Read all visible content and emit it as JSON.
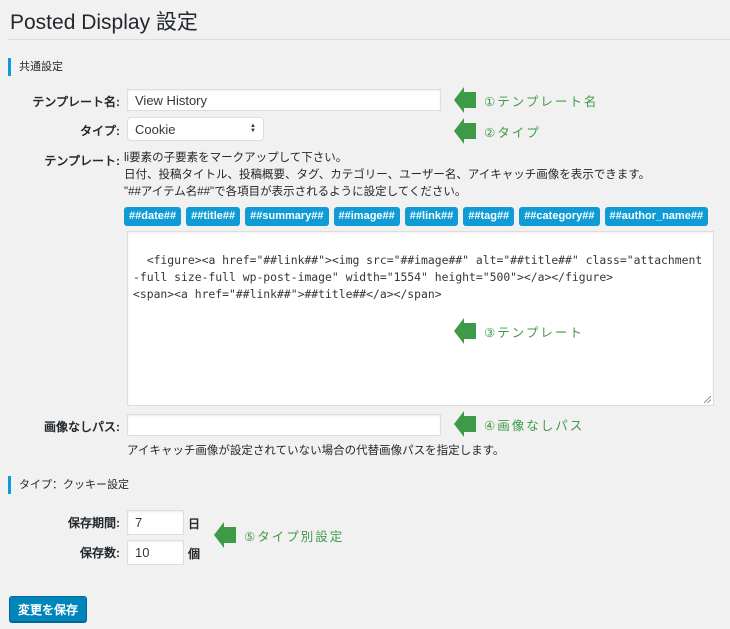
{
  "page": {
    "title": "Posted Display 設定"
  },
  "common_section": {
    "heading": "共通設定",
    "template_name": {
      "label": "テンプレート名:",
      "value": "View History"
    },
    "type": {
      "label": "タイプ:",
      "selected": "Cookie"
    },
    "template": {
      "label": "テンプレート:",
      "help_lines": [
        "li要素の子要素をマークアップして下さい。",
        "日付、投稿タイトル、投稿概要、タグ、カテゴリー、ユーザー名、アイキャッチ画像を表示できます。",
        "\"##アイテム名##\"で各項目が表示されるように設定してください。"
      ],
      "tags": [
        "##date##",
        "##title##",
        "##summary##",
        "##image##",
        "##link##",
        "##tag##",
        "##category##",
        "##author_name##"
      ],
      "value": "<figure><a href=\"##link##\"><img src=\"##image##\" alt=\"##title##\" class=\"attachment-full size-full wp-post-image\" width=\"1554\" height=\"500\"></a></figure>\n<span><a href=\"##link##\">##title##</a></span>"
    },
    "no_image_path": {
      "label": "画像なしパス:",
      "value": "",
      "help": "アイキャッチ画像が設定されていない場合の代替画像パスを指定します。"
    }
  },
  "cookie_section": {
    "heading": "タイプ：クッキー設定",
    "period": {
      "label": "保存期間:",
      "value": "7",
      "unit": "日"
    },
    "count": {
      "label": "保存数:",
      "value": "10",
      "unit": "個"
    }
  },
  "annotations": [
    "①テンプレート名",
    "②タイプ",
    "③テンプレート",
    "④画像なしパス",
    "⑤タイプ別設定"
  ],
  "colors": {
    "section_accent": "#0e9cd9",
    "tag_bg": "#0f9bd6",
    "annotation_green": "#3e9a46",
    "primary_button": "#0085ba"
  },
  "actions": {
    "save_label": "変更を保存"
  }
}
